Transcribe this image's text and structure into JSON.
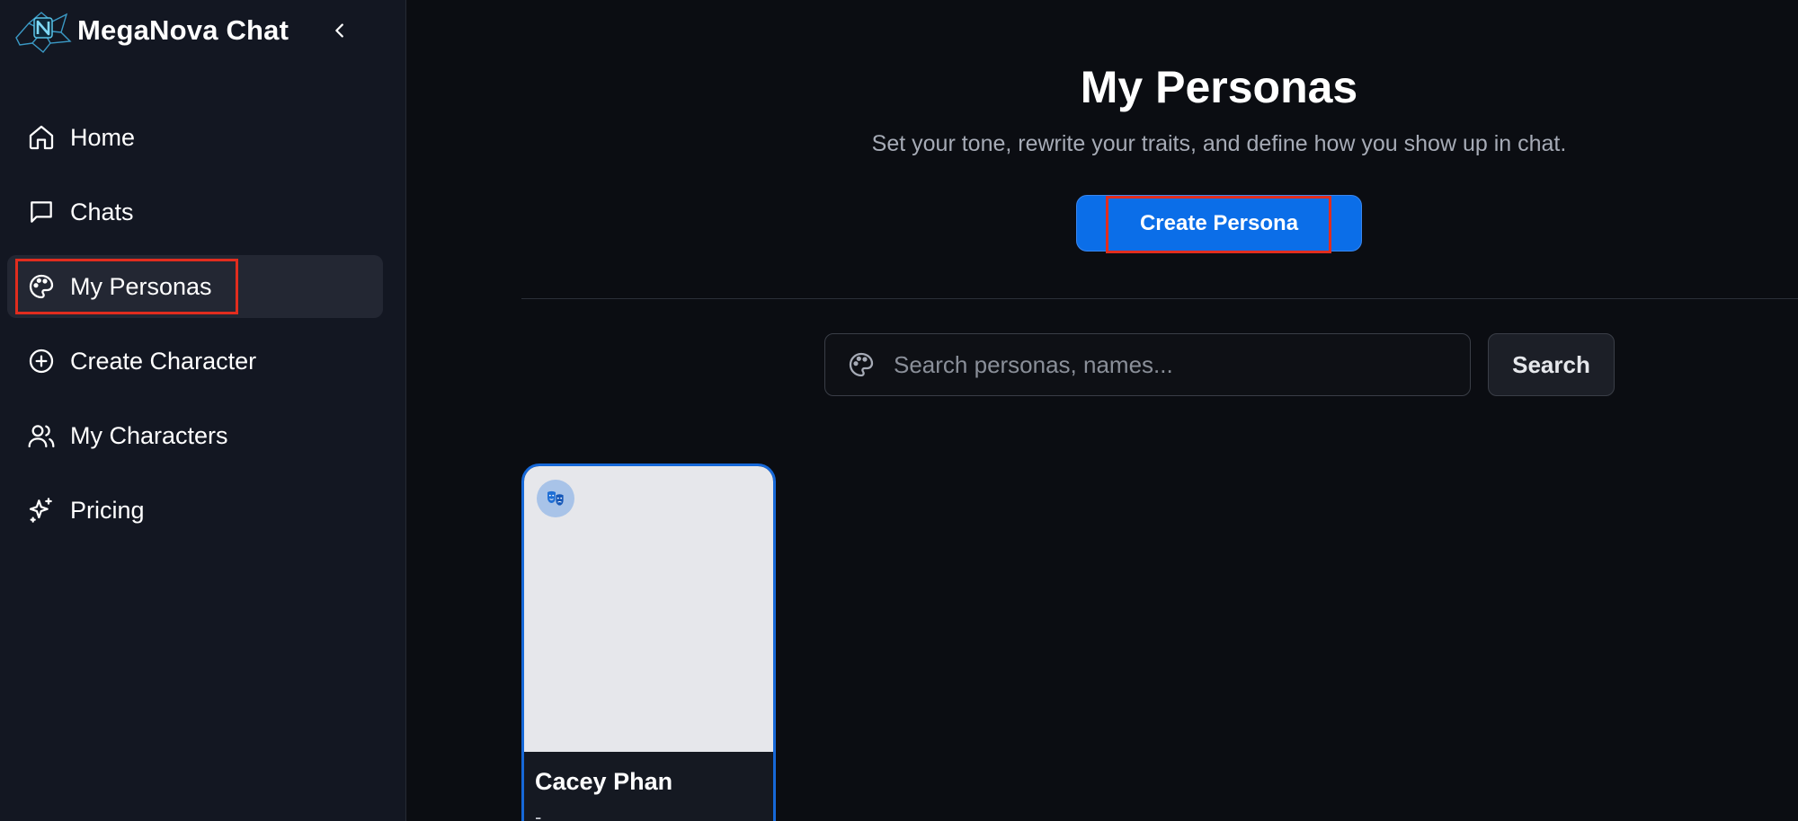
{
  "app": {
    "name": "MegaNova Chat"
  },
  "sidebar": {
    "items": [
      {
        "label": "Home",
        "icon": "home-icon"
      },
      {
        "label": "Chats",
        "icon": "chat-icon"
      },
      {
        "label": "My Personas",
        "icon": "palette-icon",
        "active": true
      },
      {
        "label": "Create Character",
        "icon": "plus-circle-icon"
      },
      {
        "label": "My Characters",
        "icon": "users-icon"
      },
      {
        "label": "Pricing",
        "icon": "sparkles-icon"
      }
    ]
  },
  "main": {
    "title": "My Personas",
    "subtitle": "Set your tone, rewrite your traits, and define how you show up in chat.",
    "create_button_label": "Create Persona",
    "search": {
      "placeholder": "Search personas, names...",
      "value": "",
      "button_label": "Search"
    },
    "personas": [
      {
        "name": "Cacey Phan",
        "description": "-"
      }
    ]
  },
  "colors": {
    "accent": "#0b6ee8",
    "sidebar_bg": "#131722",
    "page_bg": "#0b0d12",
    "highlight": "#e12d1e"
  }
}
